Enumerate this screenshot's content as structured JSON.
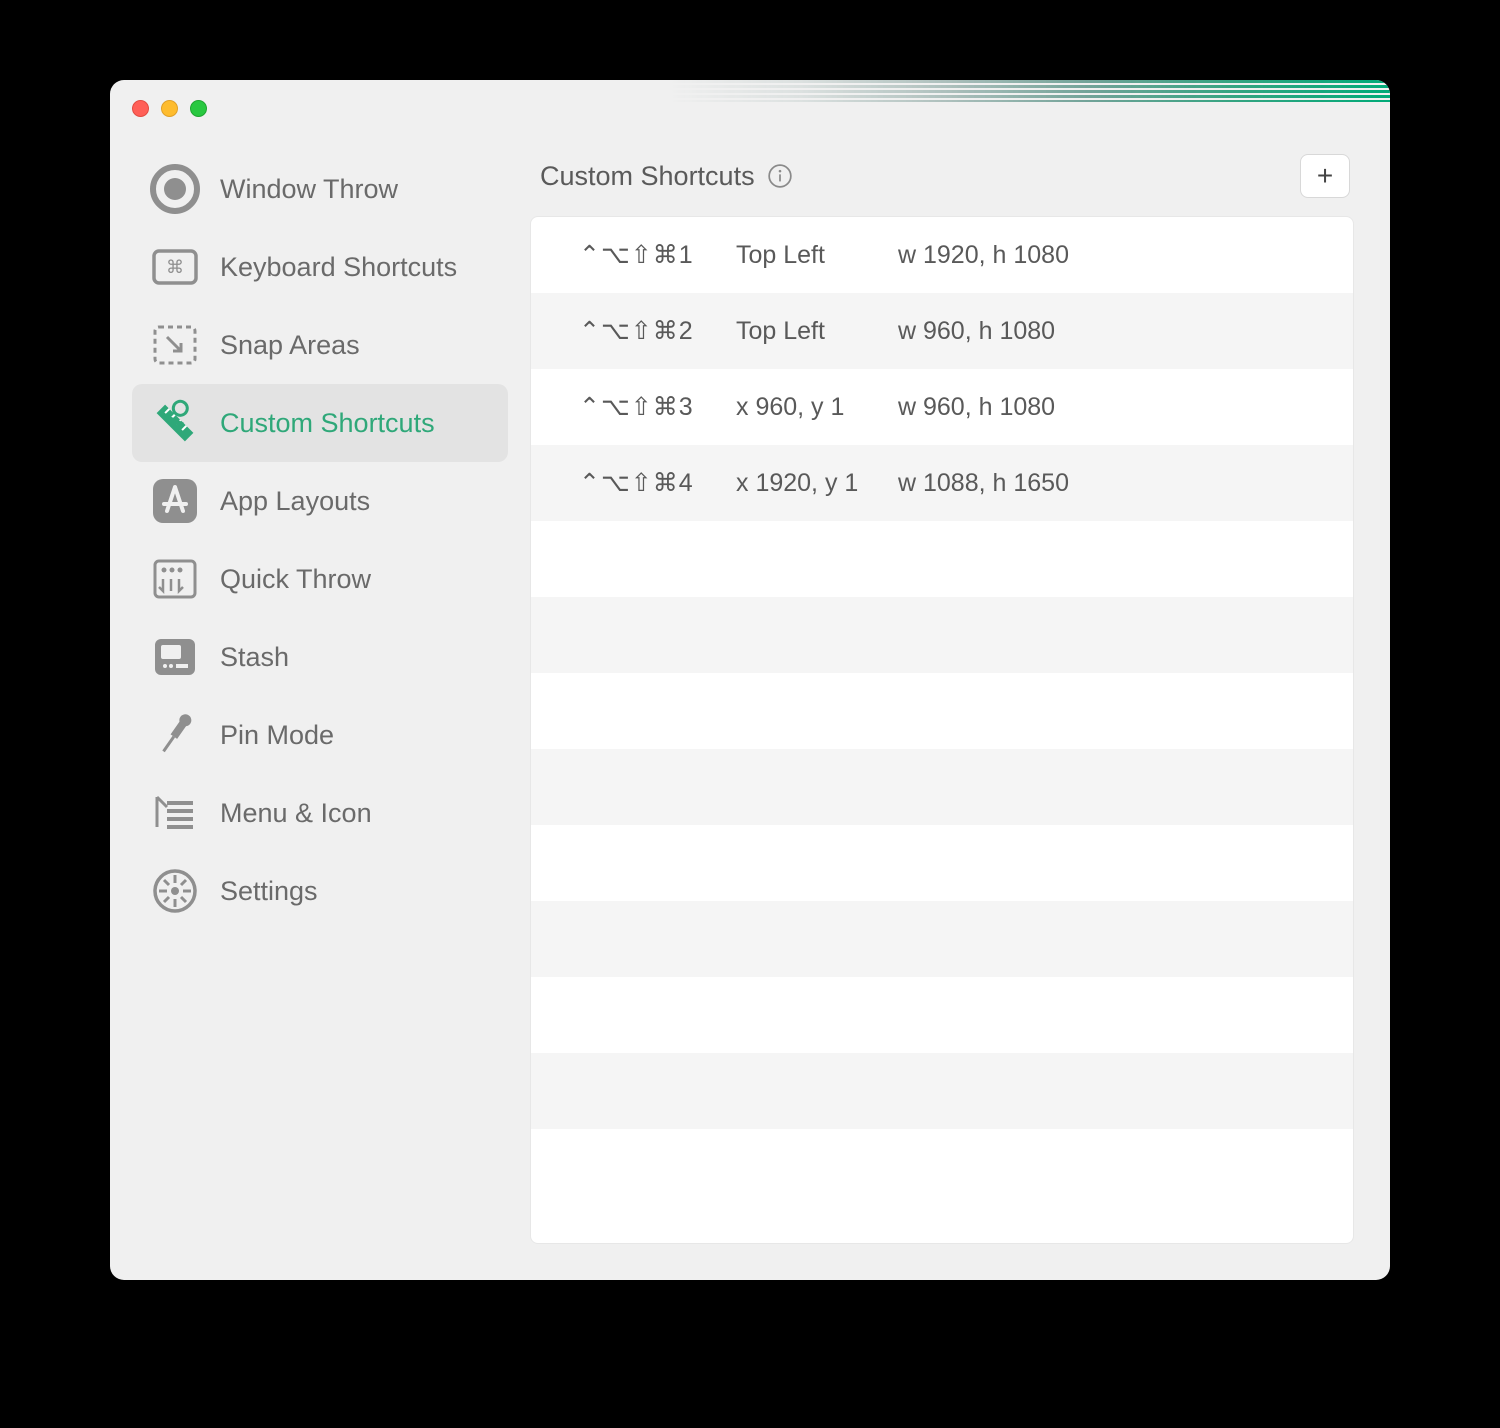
{
  "sidebar": {
    "items": [
      {
        "label": "Window Throw",
        "icon": "target",
        "active": false
      },
      {
        "label": "Keyboard Shortcuts",
        "icon": "keyboard",
        "active": false
      },
      {
        "label": "Snap Areas",
        "icon": "snap",
        "active": false
      },
      {
        "label": "Custom Shortcuts",
        "icon": "ruler",
        "active": true
      },
      {
        "label": "App Layouts",
        "icon": "appstore",
        "active": false
      },
      {
        "label": "Quick Throw",
        "icon": "quick",
        "active": false
      },
      {
        "label": "Stash",
        "icon": "stash",
        "active": false
      },
      {
        "label": "Pin Mode",
        "icon": "pin",
        "active": false
      },
      {
        "label": "Menu & Icon",
        "icon": "menu",
        "active": false
      },
      {
        "label": "Settings",
        "icon": "gear",
        "active": false
      }
    ]
  },
  "header": {
    "title": "Custom Shortcuts",
    "add_label": "+"
  },
  "shortcuts": [
    {
      "keys": "⌃⌥⇧⌘1",
      "pos": "Top Left",
      "size": "w 1920, h 1080"
    },
    {
      "keys": "⌃⌥⇧⌘2",
      "pos": "Top Left",
      "size": "w 960, h 1080"
    },
    {
      "keys": "⌃⌥⇧⌘3",
      "pos": "x 960, y 1",
      "size": "w 960, h 1080"
    },
    {
      "keys": "⌃⌥⇧⌘4",
      "pos": "x 1920, y 1",
      "size": "w 1088, h 1650"
    }
  ],
  "list_total_rows": 13
}
